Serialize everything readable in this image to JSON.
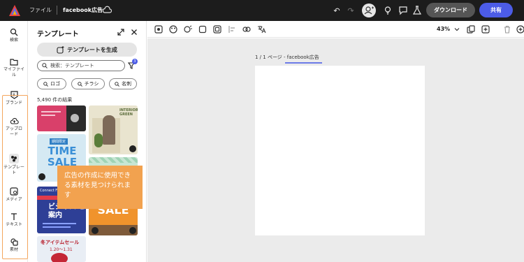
{
  "topbar": {
    "files_label": "ファイル",
    "document_title": "facebook広告",
    "download_label": "ダウンロード",
    "share_label": "共有"
  },
  "rail": {
    "items": [
      {
        "label": "検索",
        "icon": "search-icon"
      },
      {
        "label": "マイファイル",
        "icon": "folder-icon"
      },
      {
        "label": "ブランド",
        "icon": "brand-icon"
      },
      {
        "label": "アップロード",
        "icon": "upload-icon"
      },
      {
        "label": "テンプレート",
        "icon": "template-icon"
      },
      {
        "label": "メディア",
        "icon": "media-icon"
      },
      {
        "label": "テキスト",
        "icon": "text-icon"
      },
      {
        "label": "素材",
        "icon": "elements-icon"
      }
    ],
    "highlight_color": "#f4a65d"
  },
  "panel": {
    "title": "テンプレート",
    "generate_label": "テンプレートを生成",
    "search_placeholder": "検索：テンプレート",
    "filter_count": "3",
    "chips": [
      "ロゴ",
      "チラシ",
      "名刺"
    ],
    "results": "5,490 件の結果"
  },
  "thumbnails": {
    "interior_text": "INTERIOR GREEN",
    "time_sale_top": "期間限定",
    "time_sale_main": "TIME SALE",
    "blue_title": "ビジネス ご案内",
    "blue_sub": "Connect Fo",
    "sale_text": "SALE",
    "red_title": "冬アイテムセール",
    "red_dates": "1.20～1.31"
  },
  "tooltip": {
    "text": "広告の作成に使用できる素材を見つけられます"
  },
  "canvas": {
    "zoom": "43%",
    "page_label": "1 / 1 ページ - facebook広告"
  },
  "colors": {
    "accent": "#4c5ce7",
    "tooltip": "#f2a24f",
    "topbar": "#1c1c1c"
  }
}
